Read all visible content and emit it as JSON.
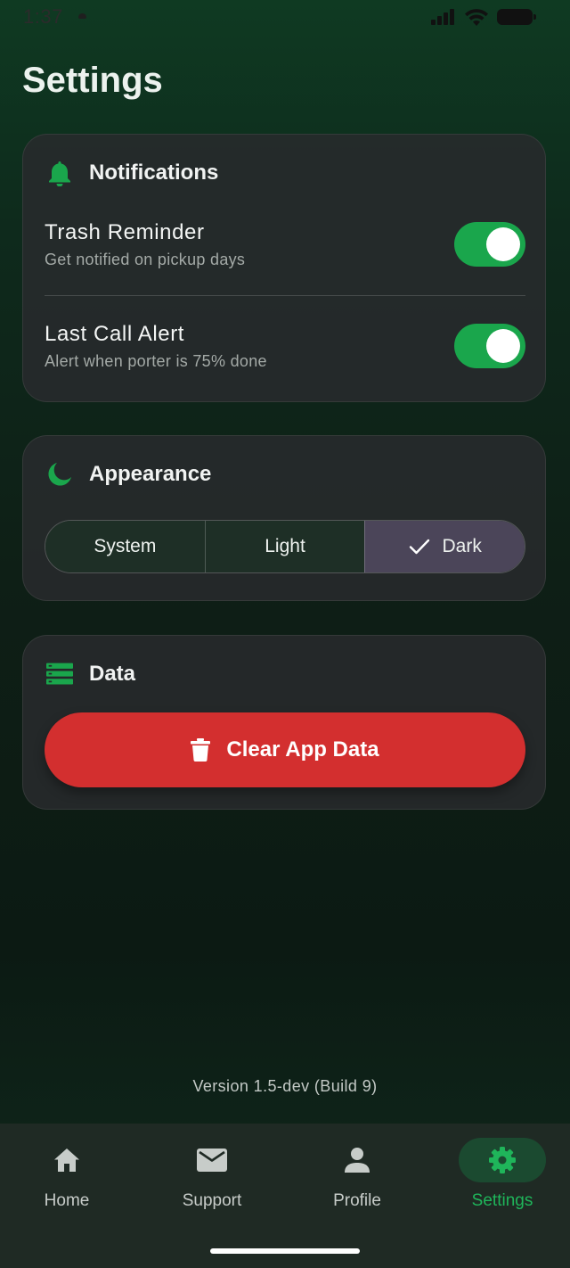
{
  "status_bar": {
    "time": "1:37",
    "icons": [
      "signal-icon",
      "wifi-icon",
      "battery-icon"
    ]
  },
  "page": {
    "title": "Settings"
  },
  "notifications": {
    "title": "Notifications",
    "icon": "bell-icon",
    "items": [
      {
        "label": "Trash Reminder",
        "subtitle": "Get notified on pickup days",
        "enabled": true
      },
      {
        "label": "Last Call Alert",
        "subtitle": "Alert when porter is 75% done",
        "enabled": true
      }
    ]
  },
  "appearance": {
    "title": "Appearance",
    "icon": "moon-icon",
    "options": [
      "System",
      "Light",
      "Dark"
    ],
    "selected": "Dark"
  },
  "data_section": {
    "title": "Data",
    "icon": "storage-icon",
    "clear_button_label": "Clear App Data",
    "clear_button_icon": "trash-icon"
  },
  "footer": {
    "version": "Version 1.5-dev (Build 9)"
  },
  "bottom_nav": {
    "items": [
      {
        "label": "Home",
        "icon": "home-icon"
      },
      {
        "label": "Support",
        "icon": "mail-icon"
      },
      {
        "label": "Profile",
        "icon": "person-icon"
      },
      {
        "label": "Settings",
        "icon": "gear-icon"
      }
    ],
    "active": "Settings"
  },
  "colors": {
    "accent": "#1aa64c",
    "danger": "#d32f2f",
    "selected_segment": "#4b4559",
    "card": "#282a2c"
  }
}
